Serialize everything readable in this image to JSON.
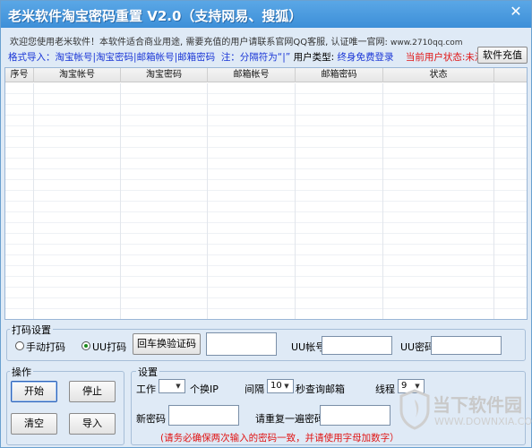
{
  "window": {
    "title": "老米软件淘宝密码重置 V2.0（支持网易、搜狐）",
    "close": "✕"
  },
  "welcome": {
    "text": "欢迎您使用老米软件！本软件适合商业用途, 需要充值的用户请联系官网QQ客服, 认证唯一官网: ",
    "site": "www.2710qq.com"
  },
  "format": {
    "label": "格式导入：",
    "fields": "淘宝帐号|淘宝密码|邮箱帐号|邮箱密码",
    "note": "注：分隔符为“|”",
    "user_type_label": "用户类型:",
    "user_type_value": "终身免费登录",
    "status_label": "当前用户状态:",
    "status_value": "未注册",
    "recharge_button": "软件充值"
  },
  "table": {
    "columns": [
      "序号",
      "淘宝帐号",
      "淘宝密码",
      "邮箱帐号",
      "邮箱密码",
      "状态"
    ],
    "rows": []
  },
  "captcha": {
    "group_title": "打码设置",
    "manual_label": "手动打码",
    "uu_label": "UU打码",
    "selected": "UU打码",
    "switch_button": "回车换验证码",
    "code_value": "",
    "uu_account_label": "UU帐号",
    "uu_account_value": "",
    "uu_password_label": "UU密码",
    "uu_password_value": ""
  },
  "operations": {
    "group_title": "操作",
    "start": "开始",
    "stop": "停止",
    "clear": "清空",
    "import": "导入"
  },
  "settings": {
    "group_title": "设置",
    "work_label": "工作",
    "work_value": "",
    "per_ip_label": "个换IP",
    "interval_label": "间隔",
    "interval_value": "10",
    "interval_suffix": "秒查询邮箱",
    "threads_label": "线程",
    "threads_value": "9",
    "new_password_label": "新密码",
    "new_password_value": "",
    "repeat_password_label": "请重复一遍密码",
    "repeat_password_value": "",
    "warning": "(请务必确保两次输入的密码一致，并请使用字母加数字）"
  },
  "watermark": {
    "text": "当下软件园",
    "sub": "WWW.DOWNXIA.COM"
  },
  "colors": {
    "title_bar": "#3d8fd8",
    "window_bg": "#dfeaf6",
    "link_blue": "#1a36d6",
    "alert_red": "#e01414"
  }
}
